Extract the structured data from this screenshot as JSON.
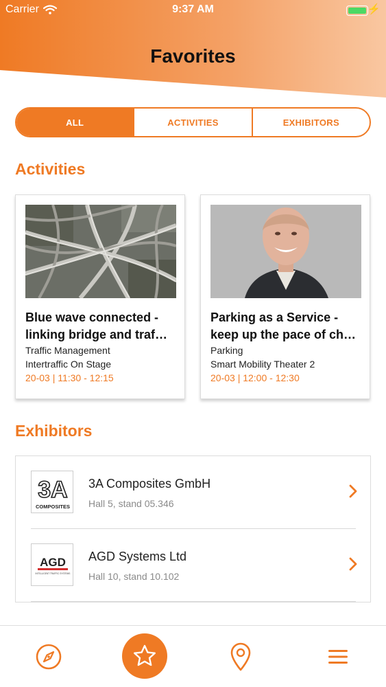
{
  "status_bar": {
    "carrier": "Carrier",
    "time": "9:37 AM"
  },
  "header": {
    "title": "Favorites"
  },
  "filters": {
    "tabs": [
      {
        "label": "ALL",
        "active": true
      },
      {
        "label": "ACTIVITIES",
        "active": false
      },
      {
        "label": "EXHIBITORS",
        "active": false
      }
    ]
  },
  "activities": {
    "section_title": "Activities",
    "items": [
      {
        "title_line1": "Blue wave connected -",
        "title_line2": "linking bridge and traf…",
        "category": "Traffic Management",
        "location": "Intertraffic On Stage",
        "time": "20-03 | 11:30 - 12:15",
        "image": "highway-interchange-photo"
      },
      {
        "title_line1": "Parking as a Service -",
        "title_line2": "keep up the pace of ch…",
        "category": "Parking",
        "location": "Smart Mobility Theater 2",
        "time": "20-03 | 12:00 - 12:30",
        "image": "speaker-portrait-photo"
      }
    ]
  },
  "exhibitors": {
    "section_title": "Exhibitors",
    "items": [
      {
        "name": "3A Composites GmbH",
        "stand": "Hall 5, stand 05.346",
        "logo_text": "3A",
        "logo_subtext": "COMPOSITES"
      },
      {
        "name": "AGD Systems Ltd",
        "stand": "Hall 10, stand 10.102",
        "logo_text": "AGD",
        "logo_subtext": "INTELLIGENT TRAFFIC SYSTEMS"
      }
    ]
  },
  "tabbar": {
    "items": [
      "compass-icon",
      "star-icon",
      "map-pin-icon",
      "menu-icon"
    ],
    "active": "star-icon"
  },
  "colors": {
    "accent": "#ef7a24",
    "header_gradient_start": "#ef7a24",
    "header_gradient_end": "#f9c7a1",
    "battery": "#4cd964",
    "secondary_text": "#8a8a8a"
  }
}
